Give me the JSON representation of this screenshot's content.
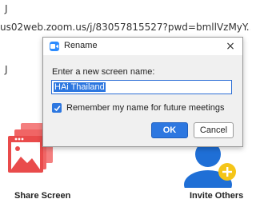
{
  "background": {
    "url_text": "us02web.zoom.us/j/83057815527?pwd=bmllVzMyY...",
    "left_char": "J",
    "top_char": "J"
  },
  "tiles": {
    "share_screen_label": "Share Screen",
    "invite_others_label": "Invite Others"
  },
  "dialog": {
    "title": "Rename",
    "close_label": "×",
    "prompt": "Enter a new screen name:",
    "name_value": "HAi Thailand",
    "remember_label": "Remember my name for future meetings",
    "remember_checked": true,
    "ok_label": "OK",
    "cancel_label": "Cancel"
  },
  "colors": {
    "accent": "#2d77e0",
    "share_screen_red": "#e94b4b",
    "invite_blue": "#1f6fd6",
    "plus_yellow": "#f5c518"
  }
}
